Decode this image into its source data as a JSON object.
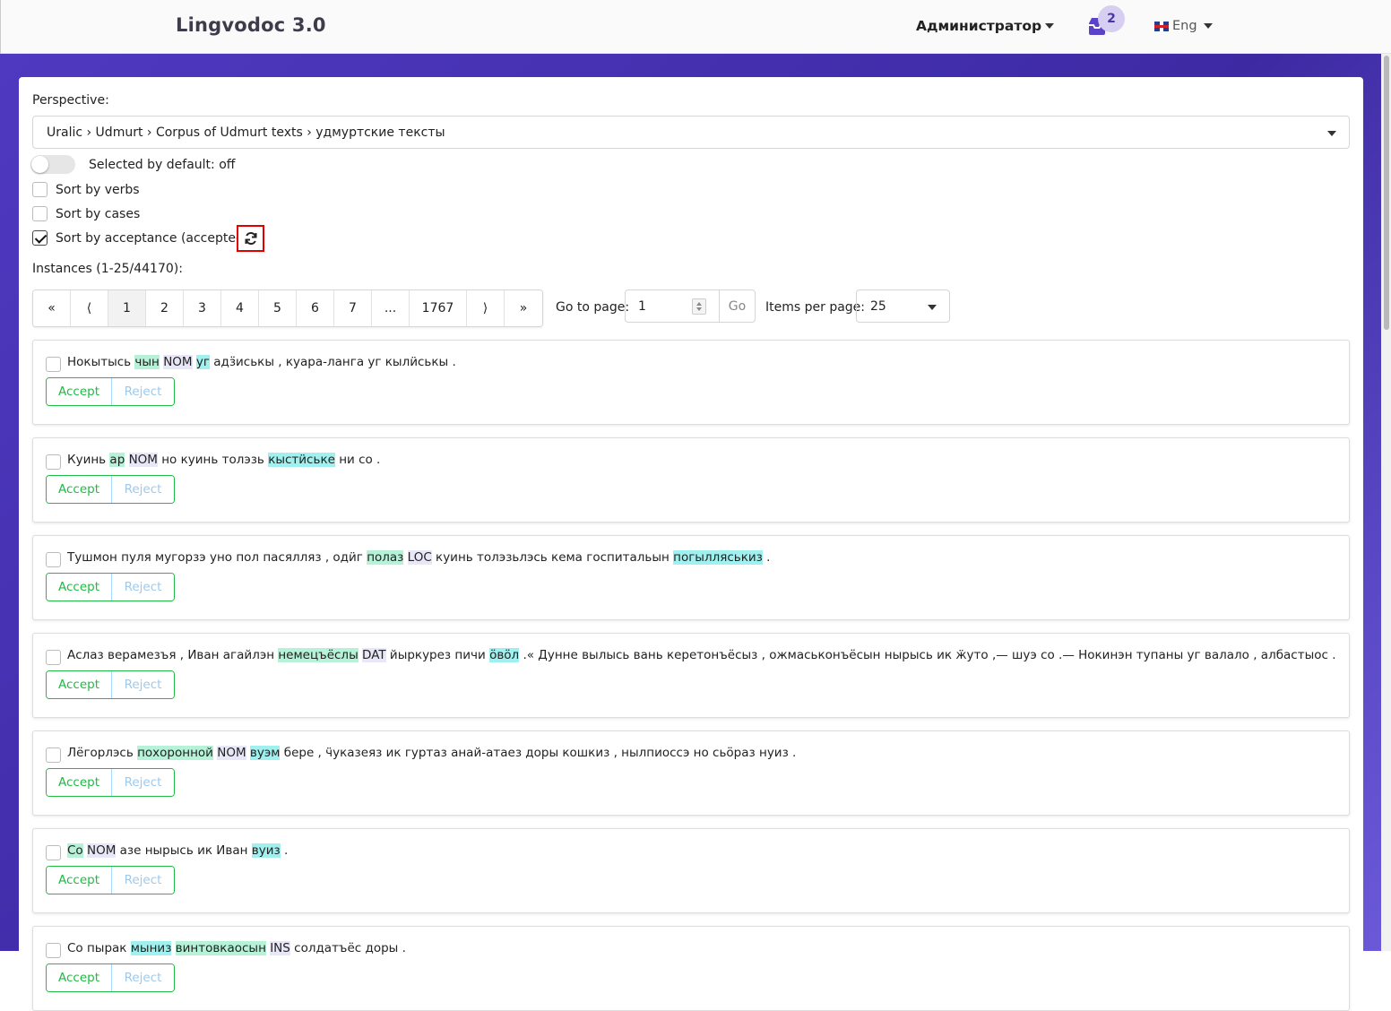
{
  "header": {
    "brand": "Lingvodoc 3.0",
    "user": "Администратор",
    "tasks_count": "2",
    "lang": "Eng"
  },
  "perspective": {
    "label": "Perspective:",
    "value": "Uralic › Udmurt › Corpus of Udmurt texts › удмуртские тексты"
  },
  "options": {
    "selected_default": "Selected by default: off",
    "selected_default_on": false,
    "sort_verbs": "Sort by verbs",
    "sort_verbs_checked": false,
    "sort_cases": "Sort by cases",
    "sort_cases_checked": false,
    "sort_acceptance": "Sort by acceptance (accepted last)",
    "sort_acceptance_checked": true
  },
  "instances_label": "Instances (1-25/44170):",
  "pagination": {
    "items": [
      "«",
      "⟨",
      "1",
      "2",
      "3",
      "4",
      "5",
      "6",
      "7",
      "...",
      "1767",
      "⟩",
      "»"
    ],
    "active": "1",
    "go_to_label": "Go to page:",
    "go_to_value": "1",
    "go_button": "Go",
    "per_page_label": "Items per page:",
    "per_page_value": "25"
  },
  "buttons": {
    "accept": "Accept",
    "reject": "Reject"
  },
  "instances": [
    {
      "parts": [
        [
          "Нокытысь ",
          ""
        ],
        [
          "чын",
          "g"
        ],
        [
          " ",
          ""
        ],
        [
          "NOM",
          "p"
        ],
        [
          " ",
          ""
        ],
        [
          "уг",
          "c"
        ],
        [
          " адӟиськы , куара-ланга уг кылӥськы .",
          ""
        ]
      ]
    },
    {
      "parts": [
        [
          "Куинь ",
          ""
        ],
        [
          "ар",
          "g"
        ],
        [
          " ",
          ""
        ],
        [
          "NOM",
          "p"
        ],
        [
          " но куинь толэзь ",
          ""
        ],
        [
          "кыстӥське",
          "c"
        ],
        [
          " ни со .",
          ""
        ]
      ]
    },
    {
      "parts": [
        [
          "Тушмон пуля мугорзэ уно пол пасялляз , одӥг ",
          ""
        ],
        [
          "полаз",
          "g"
        ],
        [
          " ",
          ""
        ],
        [
          "LOC",
          "p"
        ],
        [
          " куинь толэзьлэсь кема госпитальын ",
          ""
        ],
        [
          "погылляськиз",
          "c"
        ],
        [
          " .",
          ""
        ]
      ]
    },
    {
      "parts": [
        [
          "Аслаз верамезъя , Иван агайлэн ",
          ""
        ],
        [
          "немецъёслы",
          "g"
        ],
        [
          " ",
          ""
        ],
        [
          "DAT",
          "p"
        ],
        [
          " йыркурез пичи ",
          ""
        ],
        [
          "ӧвӧл",
          "c"
        ],
        [
          " .« Дунне вылысь вань керетонъёсыз , ожмаськонъёсын нырысь ик ӝуто ,— шуэ со .— Нокинэн тупаны уг валало , албастыос .",
          ""
        ]
      ]
    },
    {
      "parts": [
        [
          "Лёгорлэсь ",
          ""
        ],
        [
          "похоронной",
          "g"
        ],
        [
          " ",
          ""
        ],
        [
          "NOM",
          "p"
        ],
        [
          " ",
          ""
        ],
        [
          "вуэм",
          "c"
        ],
        [
          " бере , ӵуказеяз ик гуртаз анай-атаез доры кошкиз , нылпиоссэ но сьӧраз нуиз .",
          ""
        ]
      ]
    },
    {
      "parts": [
        [
          "Со",
          "g"
        ],
        [
          " ",
          ""
        ],
        [
          "NOM",
          "p"
        ],
        [
          " азе нырысь ик Иван ",
          ""
        ],
        [
          "вуиз",
          "c"
        ],
        [
          " .",
          ""
        ]
      ]
    },
    {
      "parts": [
        [
          "Со пырак ",
          ""
        ],
        [
          "мыниз",
          "c"
        ],
        [
          " ",
          ""
        ],
        [
          "винтовкаосын",
          "g"
        ],
        [
          " ",
          ""
        ],
        [
          "INS",
          "p"
        ],
        [
          " солдатъёс доры .",
          ""
        ]
      ]
    }
  ]
}
